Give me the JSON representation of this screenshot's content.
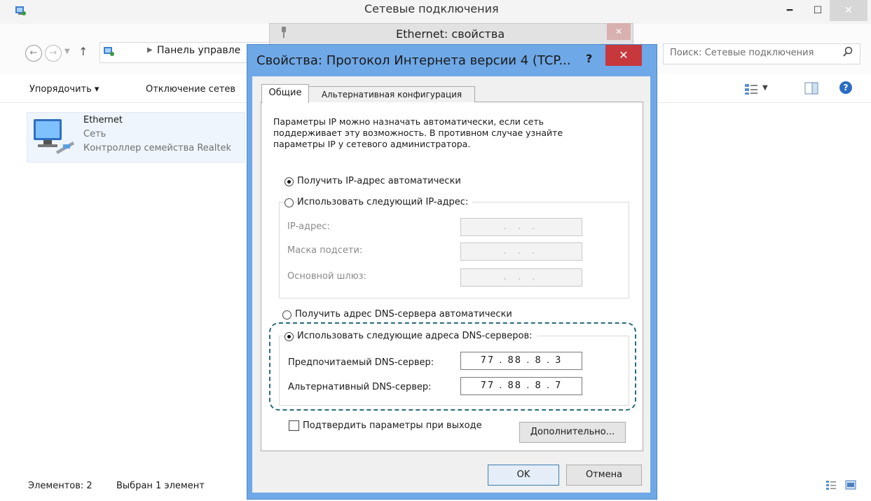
{
  "explorer": {
    "title": "Сетевые подключения",
    "address": {
      "path": "Панель управле"
    },
    "search": {
      "placeholder": "Поиск: Сетевые подключения"
    },
    "toolbar": {
      "organize": "Упорядочить ▾",
      "disable": "Отключение сетев"
    },
    "item": {
      "name": "Ethernet",
      "type": "Сеть",
      "controller": "Контроллер семейства Realtek"
    },
    "status": {
      "count": "Элементов: 2",
      "selected": "Выбран 1 элемент"
    }
  },
  "ethernet_dialog": {
    "title": "Ethernet: свойства"
  },
  "ipv4_dialog": {
    "title": "Свойства: Протокол Интернета версии 4 (TCP...",
    "help": "?",
    "close": "✕",
    "tabs": {
      "general": "Общие",
      "alternate": "Альтернативная конфигурация"
    },
    "intro": "Параметры IP можно назначать автоматически, если сеть поддерживает эту возможность. В противном случае узнайте параметры IP у сетевого администратора.",
    "ip": {
      "auto_label": "Получить IP-адрес автоматически",
      "manual_label": "Использовать следующий IP-адрес:",
      "addr_label": "IP-адрес:",
      "mask_label": "Маска подсети:",
      "gw_label": "Основной шлюз:",
      "empty_value": ". . ."
    },
    "dns": {
      "auto_label": "Получить адрес DNS-сервера автоматически",
      "manual_label": "Использовать следующие адреса DNS-серверов:",
      "pref_label": "Предпочитаемый DNS-сервер:",
      "pref_value": "77 . 88 . 8 . 3",
      "alt_label": "Альтернативный DNS-сервер:",
      "alt_value": "77 . 88 . 8 . 7"
    },
    "confirm_label": "Подтвердить параметры при выходе",
    "advanced": "Дополнительно...",
    "ok": "OK",
    "cancel": "Отмена"
  }
}
